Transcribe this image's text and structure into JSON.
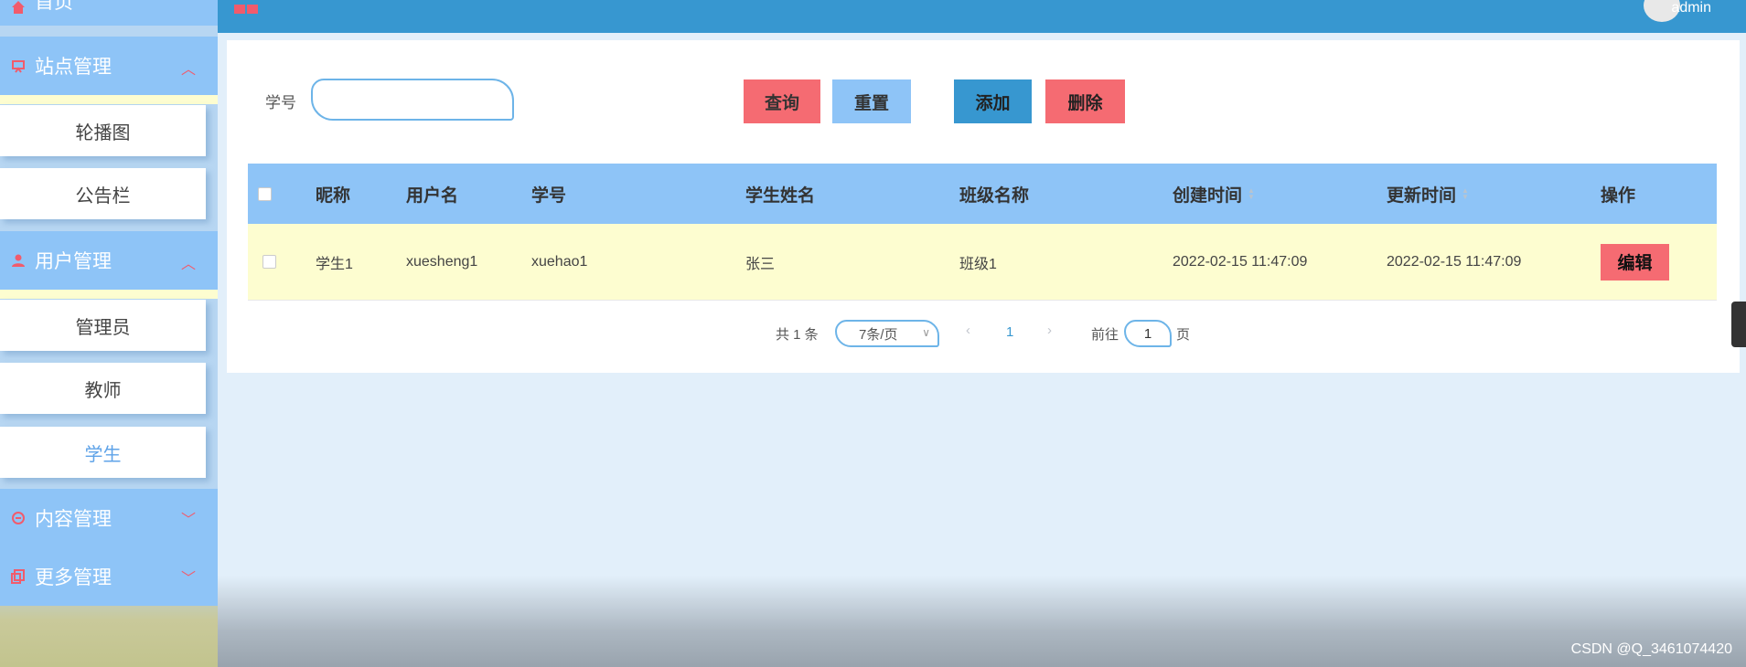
{
  "sidebar": {
    "home": "首页",
    "site_mgmt": "站点管理",
    "carousel": "轮播图",
    "notice": "公告栏",
    "user_mgmt": "用户管理",
    "admin": "管理员",
    "teacher": "教师",
    "student": "学生",
    "content_mgmt": "内容管理",
    "more_mgmt": "更多管理"
  },
  "header": {
    "username": "admin"
  },
  "search": {
    "label": "学号",
    "value": ""
  },
  "toolbar": {
    "query": "查询",
    "reset": "重置",
    "add": "添加",
    "delete": "删除"
  },
  "table": {
    "headers": [
      "昵称",
      "用户名",
      "学号",
      "学生姓名",
      "班级名称",
      "创建时间",
      "更新时间",
      "操作"
    ],
    "rows": [
      {
        "nickname": "学生1",
        "username": "xuesheng1",
        "student_no": "xuehao1",
        "student_name": "张三",
        "class_name": "班级1",
        "created": "2022-02-15 11:47:09",
        "updated": "2022-02-15 11:47:09",
        "action": "编辑"
      }
    ]
  },
  "pager": {
    "total": "共 1 条",
    "page_size": "7条/页",
    "current_page": "1",
    "goto_label": "前往",
    "goto_value": "1",
    "page_suffix": "页"
  },
  "watermark": "CSDN @Q_3461074420",
  "colors": {
    "accent_blue": "#3797d0",
    "light_blue": "#8ec4f7",
    "danger": "#f56b72",
    "row_highlight": "#fdfdd0"
  }
}
